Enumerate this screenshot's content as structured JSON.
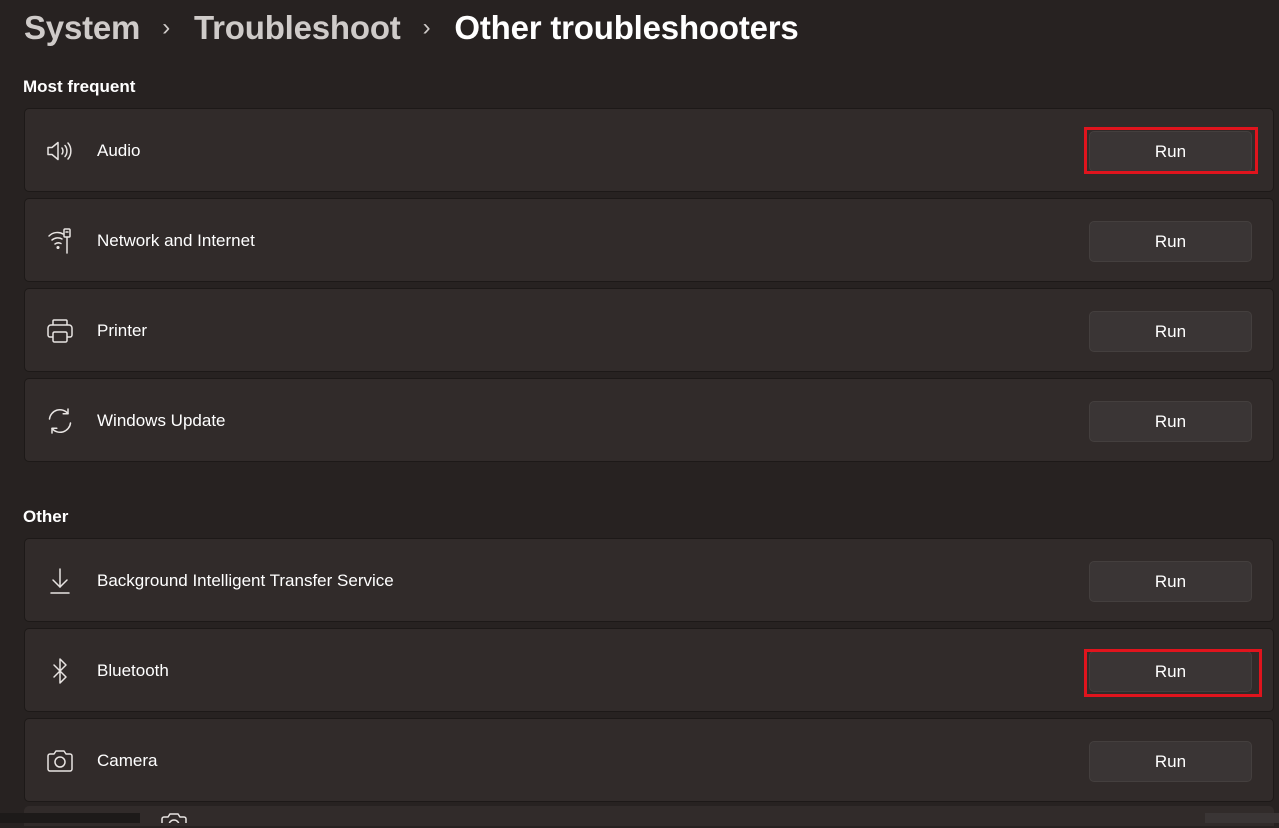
{
  "breadcrumb": {
    "items": [
      "System",
      "Troubleshoot"
    ],
    "current": "Other troubleshooters",
    "separator": "›"
  },
  "sections": {
    "most_frequent": {
      "title": "Most frequent",
      "items": [
        {
          "label": "Audio",
          "icon": "speaker-icon",
          "button": "Run",
          "highlighted": true
        },
        {
          "label": "Network and Internet",
          "icon": "network-icon",
          "button": "Run",
          "highlighted": false
        },
        {
          "label": "Printer",
          "icon": "printer-icon",
          "button": "Run",
          "highlighted": false
        },
        {
          "label": "Windows Update",
          "icon": "update-icon",
          "button": "Run",
          "highlighted": false
        }
      ]
    },
    "other": {
      "title": "Other",
      "items": [
        {
          "label": "Background Intelligent Transfer Service",
          "icon": "download-icon",
          "button": "Run",
          "highlighted": false
        },
        {
          "label": "Bluetooth",
          "icon": "bluetooth-icon",
          "button": "Run",
          "highlighted": true
        },
        {
          "label": "Camera",
          "icon": "camera-icon",
          "button": "Run",
          "highlighted": false
        }
      ]
    }
  },
  "colors": {
    "background": "#272221",
    "card": "#312b2a",
    "button": "#3a3535",
    "highlight": "#e0141d"
  }
}
